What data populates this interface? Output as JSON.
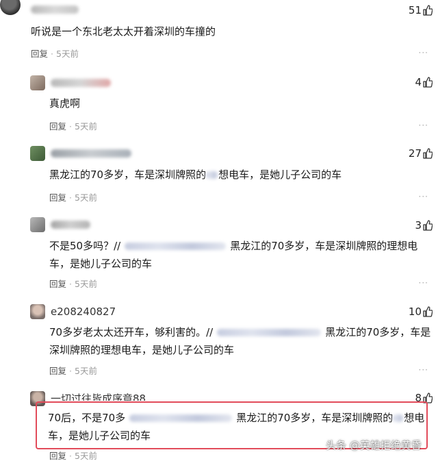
{
  "comments": [
    {
      "likes": "51",
      "text": "听说是一个东北老太太开着深圳的车撞的",
      "reply_label": "回复",
      "time": "5天前"
    },
    {
      "likes": "4",
      "text": "真虎啊",
      "reply_label": "回复",
      "time": "5天前"
    },
    {
      "likes": "27",
      "text_a": "黑龙江的70多岁，车是深圳牌照的",
      "text_b": "想电车，是她儿子公司的车",
      "reply_label": "回复",
      "time": "5天前"
    },
    {
      "likes": "3",
      "text_a": "不是50多吗？//",
      "text_b": "黑龙江的70多岁，车是深圳牌照的理想电",
      "text_c": "车，是她儿子公司的车",
      "reply_label": "回复",
      "time": "5天前"
    },
    {
      "username": "e208240827",
      "likes": "10",
      "text_a": "70多岁老太太还开车，够利害的。//",
      "text_b": "黑龙江的70多岁，车是",
      "text_c": "深圳牌照的理想电车，是她儿子公司的车",
      "reply_label": "回复",
      "time": "5天前"
    },
    {
      "username": "一切过往皆成序章88",
      "likes": "8",
      "text_a": "70后，不是70多",
      "text_b": "黑龙江的70多岁，车是深圳牌照的",
      "text_c": "想电",
      "text_d": "车，是她儿子公司的车",
      "reply_label": "回复",
      "time": "5天前"
    }
  ],
  "watermark": "头条 @英雄拒绝黄昏",
  "more_glyph": "···",
  "colors": {
    "highlight": "#e24b5a",
    "thumb": "#333333"
  }
}
